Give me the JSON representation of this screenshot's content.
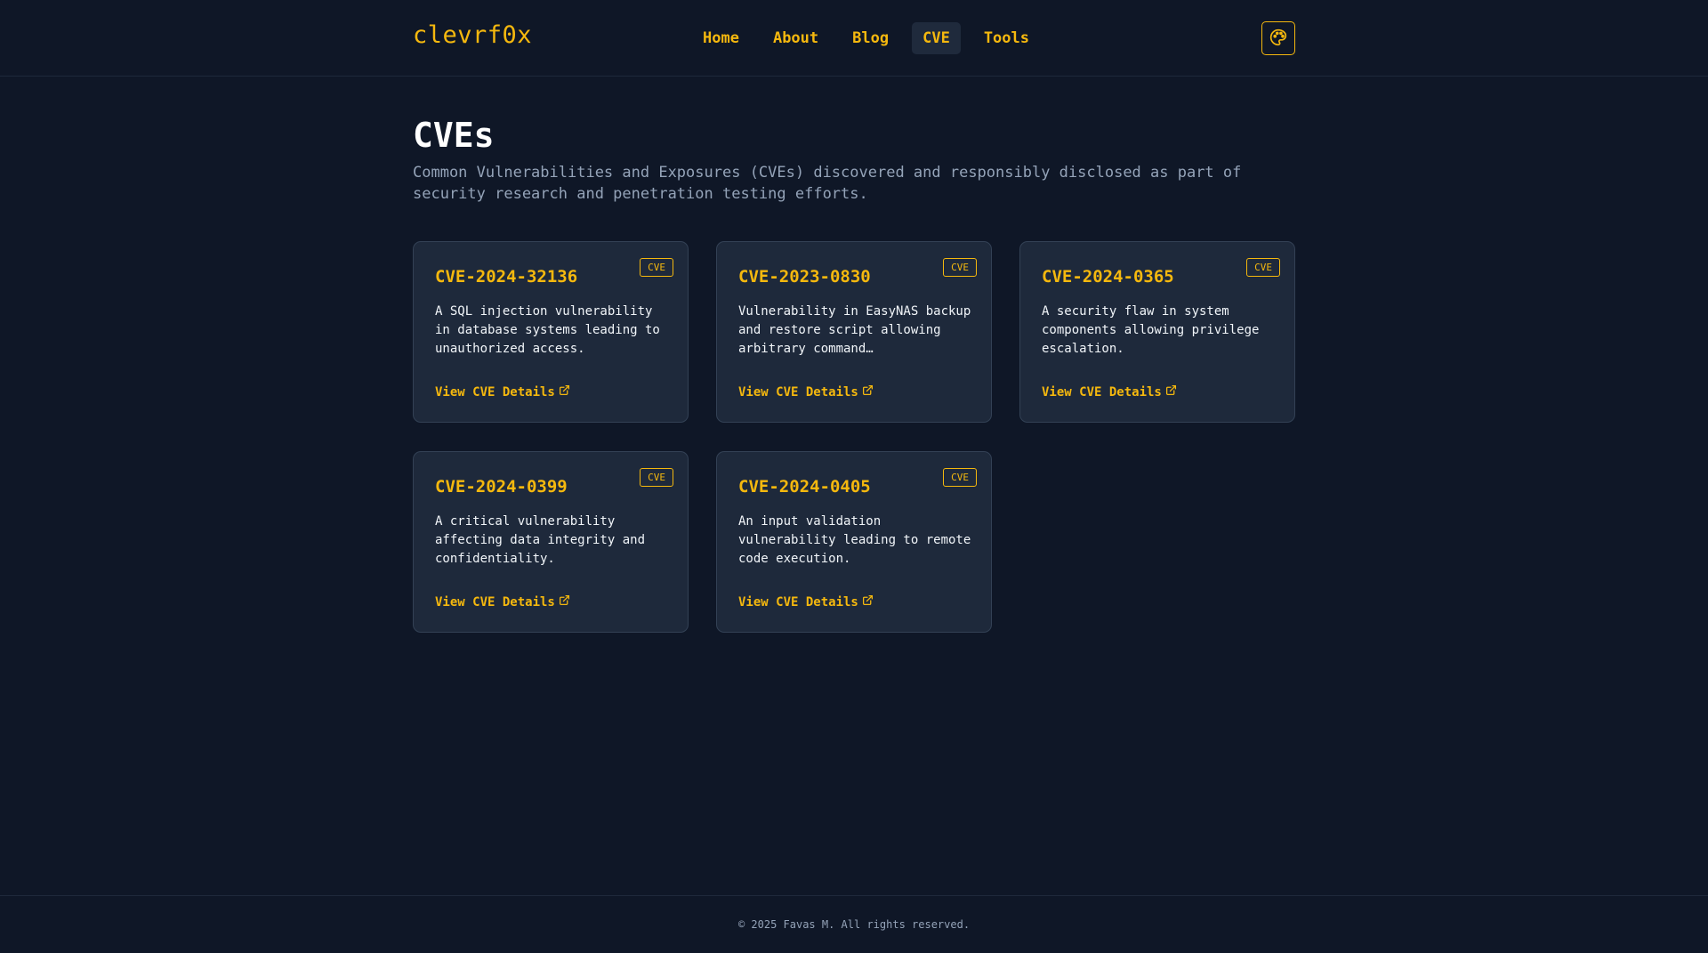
{
  "brand": "clevrf0x",
  "nav": {
    "items": [
      {
        "label": "Home"
      },
      {
        "label": "About"
      },
      {
        "label": "Blog"
      },
      {
        "label": "CVE"
      },
      {
        "label": "Tools"
      }
    ],
    "active": "CVE"
  },
  "theme_button_icon": "palette-icon",
  "page": {
    "title": "CVEs",
    "description": "Common Vulnerabilities and Exposures (CVEs) discovered and responsibly disclosed as part of security research and penetration testing efforts."
  },
  "cards": [
    {
      "id": "CVE-2024-32136",
      "badge": "CVE",
      "description": "A SQL injection vulnerability in database systems leading to unauthorized access.",
      "link_label": "View CVE Details"
    },
    {
      "id": "CVE-2023-0830",
      "badge": "CVE",
      "description": "Vulnerability in EasyNAS backup and restore script allowing arbitrary command…",
      "link_label": "View CVE Details"
    },
    {
      "id": "CVE-2024-0365",
      "badge": "CVE",
      "description": "A security flaw in system components allowing privilege escalation.",
      "link_label": "View CVE Details"
    },
    {
      "id": "CVE-2024-0399",
      "badge": "CVE",
      "description": "A critical vulnerability affecting data integrity and confidentiality.",
      "link_label": "View CVE Details"
    },
    {
      "id": "CVE-2024-0405",
      "badge": "CVE",
      "description": "An input validation vulnerability leading to remote code execution.",
      "link_label": "View CVE Details"
    }
  ],
  "footer": {
    "text": "© 2025 Favas M. All rights reserved."
  },
  "colors": {
    "background": "#0f1727",
    "card": "#1e293b",
    "accent": "#f5b80e"
  }
}
